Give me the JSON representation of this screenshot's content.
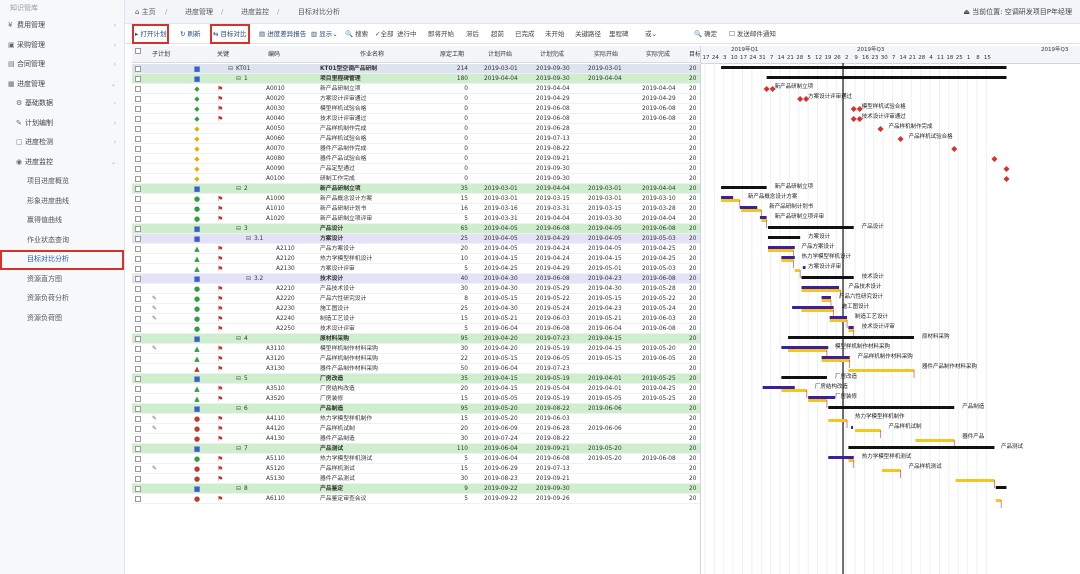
{
  "sidebar": {
    "top_label": "知识管库",
    "items": [
      {
        "label": "费用管理",
        "icon": "¥",
        "arrow": "›",
        "level": 0
      },
      {
        "label": "采购管理",
        "icon": "▣",
        "arrow": "›",
        "level": 0
      },
      {
        "label": "合同管理",
        "icon": "▤",
        "arrow": "›",
        "level": 0
      },
      {
        "label": "进度管理",
        "icon": "▦",
        "arrow": "⌄",
        "level": 0
      },
      {
        "label": "基础数据",
        "icon": "⚙",
        "arrow": "›",
        "level": 1
      },
      {
        "label": "计划编制",
        "icon": "✎",
        "arrow": "›",
        "level": 1
      },
      {
        "label": "进度检测",
        "icon": "▢",
        "arrow": "›",
        "level": 1
      },
      {
        "label": "进度监控",
        "icon": "◉",
        "arrow": "⌄",
        "level": 1
      },
      {
        "label": "项目进度概览",
        "level": 2
      },
      {
        "label": "形象进度曲线",
        "level": 2
      },
      {
        "label": "赢得值曲线",
        "level": 2
      },
      {
        "label": "作业状态查询",
        "level": 2
      },
      {
        "label": "目标对比分析",
        "level": 2,
        "highlight": true
      },
      {
        "label": "资源直方图",
        "level": 2
      },
      {
        "label": "资源负荷分析",
        "level": 2
      },
      {
        "label": "资源负荷图",
        "level": 2
      }
    ]
  },
  "topbar": {
    "home": "⌂ 主页",
    "crumbs": [
      "进度管理",
      "进度监控",
      "目标对比分析"
    ],
    "sep": "/",
    "user": "⏏ 当前位置: 空调研发项目P年经理"
  },
  "toolbar": {
    "open_plan": "▸ 打开计划",
    "refresh": "↻ 刷新",
    "target_compare": "⇆ 目标对比",
    "progress_report": "▤ 进度差异报告",
    "display": "▥ 显示⌄",
    "search": "🔍 搜索",
    "filters": [
      "✓全部",
      "进行中",
      "即将开始",
      "滞后",
      "超前",
      "已完成",
      "未开始",
      "关键路径",
      "里程碑",
      "或⌄"
    ],
    "confirm": "🔍 确定",
    "notify": "☐ 发送邮件通知"
  },
  "grid": {
    "headers": [
      "子计划",
      "关键",
      "编码",
      "作业名称",
      "原定工期",
      "计划开始",
      "计划完成",
      "实际开始",
      "实际完成",
      "目标"
    ],
    "rows": [
      {
        "type": "root",
        "code": "KT01",
        "name": "KT01型空调产品研制",
        "dur": "214",
        "ps": "2019-03-01",
        "pf": "2019-09-30",
        "as": "2019-03-01",
        "af": "",
        "t": "20",
        "ind": 0
      },
      {
        "type": "g1",
        "code": "1",
        "name": "项目里程碑管理",
        "dur": "180",
        "ps": "2019-04-04",
        "pf": "2019-09-30",
        "as": "2019-04-04",
        "af": "",
        "t": "20",
        "ind": 1
      },
      {
        "type": "task",
        "code": "A0010",
        "name": "新产品研制立项",
        "dur": "0",
        "ps": "",
        "pf": "2019-04-04",
        "as": "",
        "af": "2019-04-04",
        "t": "20",
        "ic": "◆",
        "col": "#2e9e3e",
        "ind": 2
      },
      {
        "type": "task",
        "code": "A0020",
        "name": "方案设计评审通过",
        "dur": "0",
        "ps": "",
        "pf": "2019-04-29",
        "as": "",
        "af": "2019-04-29",
        "t": "20",
        "ic": "◆",
        "col": "#2e9e3e",
        "ind": 2
      },
      {
        "type": "task",
        "code": "A0030",
        "name": "模型样机试验合格",
        "dur": "0",
        "ps": "",
        "pf": "2019-06-08",
        "as": "",
        "af": "2019-06-08",
        "t": "20",
        "ic": "◆",
        "col": "#2e9e3e",
        "ind": 2
      },
      {
        "type": "task",
        "code": "A0040",
        "name": "技术设计评审通过",
        "dur": "0",
        "ps": "",
        "pf": "2019-06-08",
        "as": "",
        "af": "2019-06-08",
        "t": "20",
        "ic": "◆",
        "col": "#2e9e3e",
        "ind": 2
      },
      {
        "type": "task",
        "code": "A0050",
        "name": "产品样机制作完成",
        "dur": "0",
        "ps": "",
        "pf": "2019-06-28",
        "as": "",
        "af": "",
        "t": "20",
        "ic": "◆",
        "col": "#e0b000",
        "ind": 2
      },
      {
        "type": "task",
        "code": "A0060",
        "name": "产品样机试验合格",
        "dur": "0",
        "ps": "",
        "pf": "2019-07-13",
        "as": "",
        "af": "",
        "t": "20",
        "ic": "◆",
        "col": "#e0b000",
        "ind": 2
      },
      {
        "type": "task",
        "code": "A0070",
        "name": "器件产品制作完成",
        "dur": "0",
        "ps": "",
        "pf": "2019-08-22",
        "as": "",
        "af": "",
        "t": "20",
        "ic": "◆",
        "col": "#e0b000",
        "ind": 2
      },
      {
        "type": "task",
        "code": "A0080",
        "name": "器件产品试验合格",
        "dur": "0",
        "ps": "",
        "pf": "2019-09-21",
        "as": "",
        "af": "",
        "t": "20",
        "ic": "◆",
        "col": "#e0b000",
        "ind": 2
      },
      {
        "type": "task",
        "code": "A0090",
        "name": "产品定型通过",
        "dur": "0",
        "ps": "",
        "pf": "2019-09-30",
        "as": "",
        "af": "",
        "t": "20",
        "ic": "◆",
        "col": "#e0b000",
        "ind": 2
      },
      {
        "type": "task",
        "code": "A0100",
        "name": "研制工作完成",
        "dur": "0",
        "ps": "",
        "pf": "2019-09-30",
        "as": "",
        "af": "",
        "t": "20",
        "ic": "◆",
        "col": "#e0b000",
        "ind": 2
      },
      {
        "type": "g1",
        "code": "2",
        "name": "新产品研制立项",
        "dur": "35",
        "ps": "2019-03-01",
        "pf": "2019-04-04",
        "as": "2019-03-01",
        "af": "2019-04-04",
        "t": "20",
        "ind": 1
      },
      {
        "type": "task",
        "code": "A1000",
        "name": "新产品概念设计方案",
        "dur": "15",
        "ps": "2019-03-01",
        "pf": "2019-03-15",
        "as": "2019-03-01",
        "af": "2019-03-10",
        "t": "20",
        "ic": "●",
        "col": "#2e9e3e",
        "ind": 2
      },
      {
        "type": "task",
        "code": "A1010",
        "name": "新产品研制计划书",
        "dur": "16",
        "ps": "2019-03-16",
        "pf": "2019-03-31",
        "as": "2019-03-15",
        "af": "2019-03-28",
        "t": "20",
        "ic": "●",
        "col": "#2e9e3e",
        "ind": 2
      },
      {
        "type": "task",
        "code": "A1020",
        "name": "新产品研制立项评审",
        "dur": "5",
        "ps": "2019-03-31",
        "pf": "2019-04-04",
        "as": "2019-03-30",
        "af": "2019-04-04",
        "t": "20",
        "ic": "●",
        "col": "#2e9e3e",
        "ind": 2
      },
      {
        "type": "g1",
        "code": "3",
        "name": "产品设计",
        "dur": "65",
        "ps": "2019-04-05",
        "pf": "2019-06-08",
        "as": "2019-04-05",
        "af": "2019-06-08",
        "t": "20",
        "ind": 1
      },
      {
        "type": "g2",
        "code": "3.1",
        "name": "方案设计",
        "dur": "25",
        "ps": "2019-04-05",
        "pf": "2019-04-29",
        "as": "2019-04-05",
        "af": "2019-05-03",
        "t": "20",
        "ind": 2
      },
      {
        "type": "task",
        "code": "A2110",
        "name": "产品方案设计",
        "dur": "20",
        "ps": "2019-04-05",
        "pf": "2019-04-24",
        "as": "2019-04-05",
        "af": "2019-04-25",
        "t": "20",
        "ic": "▲",
        "col": "#2e9e3e",
        "ind": 3
      },
      {
        "type": "task",
        "code": "A2120",
        "name": "热力学模型样机设计",
        "dur": "10",
        "ps": "2019-04-15",
        "pf": "2019-04-24",
        "as": "2019-04-15",
        "af": "2019-04-25",
        "t": "20",
        "ic": "▲",
        "col": "#2e9e3e",
        "ind": 3
      },
      {
        "type": "task",
        "code": "A2130",
        "name": "方案设计评审",
        "dur": "5",
        "ps": "2019-04-25",
        "pf": "2019-04-29",
        "as": "2019-05-01",
        "af": "2019-05-03",
        "t": "20",
        "ic": "▲",
        "col": "#2e9e3e",
        "ind": 3
      },
      {
        "type": "g2",
        "code": "3.2",
        "name": "技术设计",
        "dur": "40",
        "ps": "2019-04-30",
        "pf": "2019-06-08",
        "as": "2019-04-23",
        "af": "2019-06-08",
        "t": "20",
        "ind": 2
      },
      {
        "type": "task",
        "code": "A2210",
        "name": "产品技术设计",
        "dur": "30",
        "ps": "2019-04-30",
        "pf": "2019-05-29",
        "as": "2019-04-30",
        "af": "2019-05-28",
        "t": "20",
        "ic": "●",
        "col": "#2e9e3e",
        "ind": 3
      },
      {
        "type": "task",
        "code": "A2220",
        "name": "产品六性研究设计",
        "dur": "8",
        "ps": "2019-05-15",
        "pf": "2019-05-22",
        "as": "2019-05-15",
        "af": "2019-05-22",
        "t": "20",
        "ic": "●",
        "col": "#2e9e3e",
        "ind": 3
      },
      {
        "type": "task",
        "code": "A2230",
        "name": "施工图设计",
        "dur": "25",
        "ps": "2019-04-30",
        "pf": "2019-05-24",
        "as": "2019-04-23",
        "af": "2019-05-24",
        "t": "20",
        "ic": "●",
        "col": "#2e9e3e",
        "ind": 3
      },
      {
        "type": "task",
        "code": "A2240",
        "name": "制造工艺设计",
        "dur": "15",
        "ps": "2019-05-21",
        "pf": "2019-06-03",
        "as": "2019-05-21",
        "af": "2019-06-03",
        "t": "20",
        "ic": "●",
        "col": "#2e9e3e",
        "ind": 3
      },
      {
        "type": "task",
        "code": "A2250",
        "name": "技术设计评审",
        "dur": "5",
        "ps": "2019-06-04",
        "pf": "2019-06-08",
        "as": "2019-06-04",
        "af": "2019-06-08",
        "t": "20",
        "ic": "●",
        "col": "#2e9e3e",
        "ind": 3
      },
      {
        "type": "g1",
        "code": "4",
        "name": "原材料采购",
        "dur": "95",
        "ps": "2019-04-20",
        "pf": "2019-07-23",
        "as": "2019-04-15",
        "af": "",
        "t": "20",
        "ind": 1
      },
      {
        "type": "task",
        "code": "A3110",
        "name": "模型样机制作材料采购",
        "dur": "30",
        "ps": "2019-04-20",
        "pf": "2019-05-19",
        "as": "2019-04-15",
        "af": "2019-05-20",
        "t": "20",
        "ic": "▲",
        "col": "#2e9e3e",
        "ind": 2
      },
      {
        "type": "task",
        "code": "A3120",
        "name": "产品样机制作材料采购",
        "dur": "22",
        "ps": "2019-05-15",
        "pf": "2019-06-05",
        "as": "2019-05-15",
        "af": "2019-06-05",
        "t": "20",
        "ic": "▲",
        "col": "#2e9e3e",
        "ind": 2
      },
      {
        "type": "task",
        "code": "A3130",
        "name": "器件产品制作材料采购",
        "dur": "50",
        "ps": "2019-06-04",
        "pf": "2019-07-23",
        "as": "",
        "af": "",
        "t": "20",
        "ic": "▲",
        "col": "#c0392b",
        "ind": 2
      },
      {
        "type": "g1",
        "code": "5",
        "name": "厂房改造",
        "dur": "35",
        "ps": "2019-04-15",
        "pf": "2019-05-19",
        "as": "2019-04-01",
        "af": "2019-05-25",
        "t": "20",
        "ind": 1
      },
      {
        "type": "task",
        "code": "A3510",
        "name": "厂房结构改造",
        "dur": "20",
        "ps": "2019-04-15",
        "pf": "2019-05-04",
        "as": "2019-04-01",
        "af": "2019-04-25",
        "t": "20",
        "ic": "▲",
        "col": "#2e9e3e",
        "ind": 2
      },
      {
        "type": "task",
        "code": "A3520",
        "name": "厂房装修",
        "dur": "15",
        "ps": "2019-05-05",
        "pf": "2019-05-19",
        "as": "2019-05-05",
        "af": "2019-05-25",
        "t": "20",
        "ic": "▲",
        "col": "#2e9e3e",
        "ind": 2
      },
      {
        "type": "g1",
        "code": "6",
        "name": "产品制造",
        "dur": "95",
        "ps": "2019-05-20",
        "pf": "2019-08-22",
        "as": "2019-06-06",
        "af": "",
        "t": "20",
        "ind": 1
      },
      {
        "type": "task",
        "code": "A4110",
        "name": "热力学模型样机制作",
        "dur": "15",
        "ps": "2019-05-20",
        "pf": "2019-06-03",
        "as": "",
        "af": "",
        "t": "20",
        "ic": "●",
        "col": "#c0392b",
        "ind": 2
      },
      {
        "type": "task",
        "code": "A4120",
        "name": "产品样机试制",
        "dur": "20",
        "ps": "2019-06-09",
        "pf": "2019-06-28",
        "as": "2019-06-06",
        "af": "",
        "t": "20",
        "ic": "●",
        "col": "#c0392b",
        "ind": 2
      },
      {
        "type": "task",
        "code": "A4130",
        "name": "器件产品制造",
        "dur": "30",
        "ps": "2019-07-24",
        "pf": "2019-08-22",
        "as": "",
        "af": "",
        "t": "20",
        "ic": "●",
        "col": "#c0392b",
        "ind": 2
      },
      {
        "type": "g1",
        "code": "7",
        "name": "产品测试",
        "dur": "110",
        "ps": "2019-06-04",
        "pf": "2019-09-21",
        "as": "2019-05-20",
        "af": "",
        "t": "20",
        "ind": 1
      },
      {
        "type": "task",
        "code": "A5110",
        "name": "热力学模型样机测试",
        "dur": "5",
        "ps": "2019-06-04",
        "pf": "2019-06-08",
        "as": "2019-05-20",
        "af": "2019-06-08",
        "t": "20",
        "ic": "●",
        "col": "#2e9e3e",
        "ind": 2
      },
      {
        "type": "task",
        "code": "A5120",
        "name": "产品样机测试",
        "dur": "15",
        "ps": "2019-06-29",
        "pf": "2019-07-13",
        "as": "",
        "af": "",
        "t": "20",
        "ic": "●",
        "col": "#c0392b",
        "ind": 2
      },
      {
        "type": "task",
        "code": "A5130",
        "name": "器件产品测试",
        "dur": "30",
        "ps": "2019-08-23",
        "pf": "2019-09-21",
        "as": "",
        "af": "",
        "t": "20",
        "ic": "●",
        "col": "#c0392b",
        "ind": 2
      },
      {
        "type": "g1",
        "code": "8",
        "name": "产品鉴定",
        "dur": "9",
        "ps": "2019-09-22",
        "pf": "2019-09-30",
        "as": "",
        "af": "",
        "t": "20",
        "ind": 1
      },
      {
        "type": "task",
        "code": "A6110",
        "name": "产品鉴定审查会议",
        "dur": "5",
        "ps": "2019-09-22",
        "pf": "2019-09-26",
        "as": "",
        "af": "",
        "t": "20",
        "ic": "●",
        "col": "#c0392b",
        "ind": 2
      }
    ]
  },
  "gantt": {
    "quarters": [
      {
        "label": "2019年Q1"
      },
      {
        "label": "2019年Q3"
      },
      {
        "label": "2019年Q3"
      }
    ],
    "days": [
      "17",
      "24",
      "3",
      "10",
      "17",
      "24",
      "31",
      "7",
      "14",
      "21",
      "28",
      "5",
      "12",
      "19",
      "26",
      "2",
      "9",
      "16",
      "23",
      "30",
      "7",
      "14",
      "21",
      "28",
      "4",
      "11",
      "18",
      "25",
      "1",
      "8",
      "15"
    ],
    "labels": [
      {
        "text": "新产品研制立项",
        "row": 2
      },
      {
        "text": "方案设计评审通过",
        "row": 3
      },
      {
        "text": "模型样机试验合格",
        "row": 4
      },
      {
        "text": "技术设计评审通过",
        "row": 5
      },
      {
        "text": "产品样机制作完成",
        "row": 6
      },
      {
        "text": "产品样机试验合格",
        "row": 7
      },
      {
        "text": "新产品研制立项",
        "row": 12
      },
      {
        "text": "新产品概念设计方案",
        "row": 13
      },
      {
        "text": "新产品研制计划书",
        "row": 14
      },
      {
        "text": "新产品研制立项评审",
        "row": 15
      },
      {
        "text": "产品设计",
        "row": 16
      },
      {
        "text": "方案设计",
        "row": 17
      },
      {
        "text": "产品方案设计",
        "row": 18
      },
      {
        "text": "热力学模型样机设计",
        "row": 19
      },
      {
        "text": "方案设计评审",
        "row": 20
      },
      {
        "text": "技术设计",
        "row": 21
      },
      {
        "text": "产品技术设计",
        "row": 22
      },
      {
        "text": "产品六性研究设计",
        "row": 23
      },
      {
        "text": "施工图设计",
        "row": 24
      },
      {
        "text": "制造工艺设计",
        "row": 25
      },
      {
        "text": "技术设计评审",
        "row": 26
      },
      {
        "text": "原材料采购",
        "row": 27
      },
      {
        "text": "模型样机制作材料采购",
        "row": 28
      },
      {
        "text": "产品样机制作材料采购",
        "row": 29
      },
      {
        "text": "器件产品制作材料采购",
        "row": 30
      },
      {
        "text": "厂房改造",
        "row": 31
      },
      {
        "text": "厂房结构改造",
        "row": 32
      },
      {
        "text": "厂房装修",
        "row": 33
      },
      {
        "text": "产品制造",
        "row": 34
      },
      {
        "text": "热力学模型样机制作",
        "row": 35
      },
      {
        "text": "产品样机试制",
        "row": 36
      },
      {
        "text": "器件产品",
        "row": 37
      },
      {
        "text": "产品测试",
        "row": 38
      },
      {
        "text": "热力学模型样机测试",
        "row": 39
      },
      {
        "text": "产品样机测试",
        "row": 40
      }
    ],
    "colors": {
      "plan": "#f3c623",
      "actual": "#3d1f9e",
      "summary": "#111111",
      "link": "#d9302c",
      "today": "#111111"
    }
  }
}
